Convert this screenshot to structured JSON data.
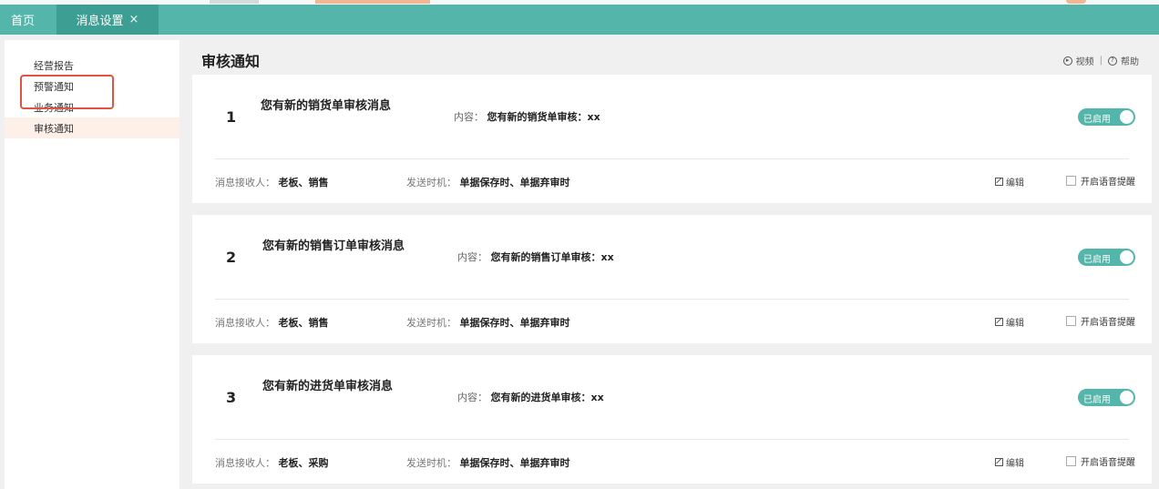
{
  "tabs": [
    {
      "label": "首页"
    },
    {
      "label": "消息设置",
      "close": "×"
    }
  ],
  "sidebar": {
    "items": [
      {
        "label": "经营报告"
      },
      {
        "label": "预警通知"
      },
      {
        "label": "业务通知"
      },
      {
        "label": "审核通知"
      }
    ]
  },
  "header": {
    "title": "审核通知",
    "video_label": "视频",
    "separator": "|",
    "help_label": "帮助"
  },
  "cards": [
    {
      "num": "1",
      "title": "您有新的销货单审核消息",
      "content_label": "内容：",
      "content_value": "您有新的销货单审核：xx",
      "toggle_label": "已启用",
      "recipients_label": "消息接收人：",
      "recipients_value": "老板、销售",
      "timing_label": "发送时机：",
      "timing_value": "单据保存时、单据弃审时",
      "edit_label": "编辑",
      "voice_label": "开启语音提醒"
    },
    {
      "num": "2",
      "title": "您有新的销售订单审核消息",
      "content_label": "内容：",
      "content_value": "您有新的销售订单审核：xx",
      "toggle_label": "已启用",
      "recipients_label": "消息接收人：",
      "recipients_value": "老板、销售",
      "timing_label": "发送时机：",
      "timing_value": "单据保存时、单据弃审时",
      "edit_label": "编辑",
      "voice_label": "开启语音提醒"
    },
    {
      "num": "3",
      "title": "您有新的进货单审核消息",
      "content_label": "内容：",
      "content_value": "您有新的进货单审核：xx",
      "toggle_label": "已启用",
      "recipients_label": "消息接收人：",
      "recipients_value": "老板、采购",
      "timing_label": "发送时机：",
      "timing_value": "单据保存时、单据弃审时",
      "edit_label": "编辑",
      "voice_label": "开启语音提醒"
    }
  ],
  "colors": {
    "accent": "#54b5aa",
    "tab_active": "#3d9f93",
    "highlight_border": "#e05340",
    "sidebar_active_bg": "#fdf0e9"
  }
}
